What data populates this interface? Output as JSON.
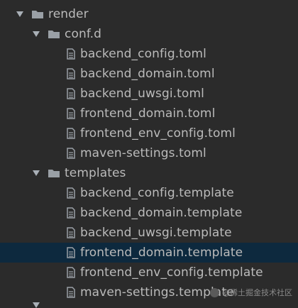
{
  "colors": {
    "background": "#2b2b2b",
    "selected_row": "#0d293e",
    "text": "#bbbbbb",
    "icon": "#9aa0a6"
  },
  "tree": {
    "root": {
      "label": "render",
      "icon": "folder-icon",
      "expanded": true
    },
    "conf_d": {
      "label": "conf.d",
      "icon": "folder-icon",
      "expanded": true,
      "files": [
        "backend_config.toml",
        "backend_domain.toml",
        "backend_uwsgi.toml",
        "frontend_domain.toml",
        "frontend_env_config.toml",
        "maven-settings.toml"
      ]
    },
    "templates": {
      "label": "templates",
      "icon": "folder-icon",
      "expanded": true,
      "files": [
        "backend_config.template",
        "backend_domain.template",
        "backend_uwsgi.template",
        "frontend_domain.template",
        "frontend_env_config.template",
        "maven-settings.template"
      ],
      "selected_index": 3
    }
  },
  "watermark": {
    "text": "@稀土掘金技术社区"
  }
}
